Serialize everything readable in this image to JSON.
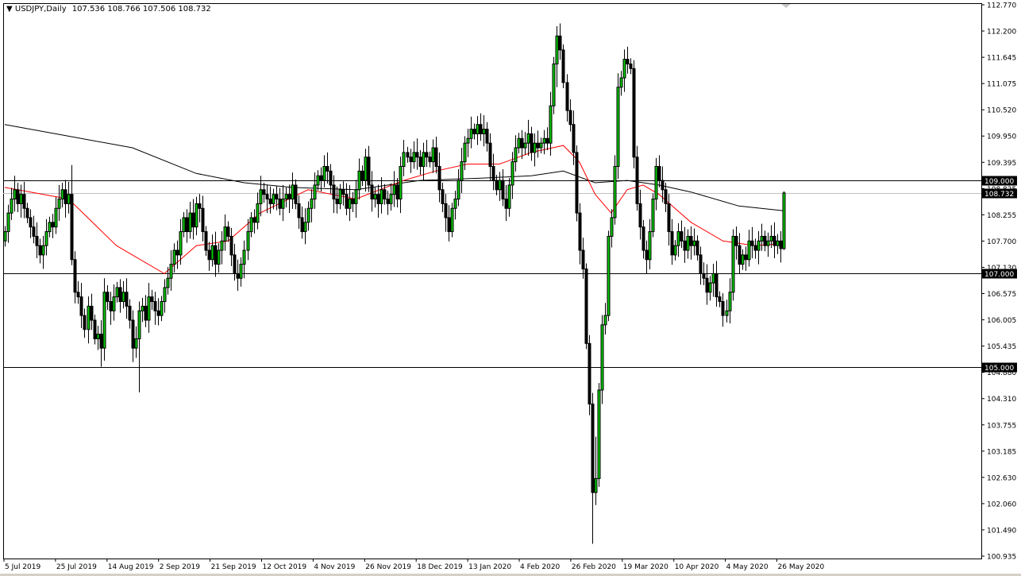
{
  "header": {
    "symbol_timeframe": "USDJPY,Daily",
    "ohlc": "107.536 108.766 107.506 108.732"
  },
  "colors": {
    "bull": "#00cc00",
    "bear": "#000000",
    "ma_fast": "#ff0000",
    "ma_slow": "#000000",
    "price_line": "#c0c0c0"
  },
  "chart_data": {
    "type": "candlestick",
    "title": "USDJPY,Daily",
    "ylim": [
      100.935,
      112.77
    ],
    "yticks": [
      "112.770",
      "112.200",
      "111.645",
      "111.075",
      "110.520",
      "109.950",
      "109.395",
      "108.825",
      "108.255",
      "107.700",
      "107.130",
      "106.575",
      "106.005",
      "105.435",
      "104.880",
      "104.310",
      "103.755",
      "103.185",
      "102.630",
      "102.060",
      "101.490",
      "100.935"
    ],
    "xticks": [
      "5 Jul 2019",
      "25 Jul 2019",
      "14 Aug 2019",
      "2 Sep 2019",
      "21 Sep 2019",
      "12 Oct 2019",
      "4 Nov 2019",
      "26 Nov 2019",
      "18 Dec 2019",
      "13 Jan 2020",
      "4 Feb 2020",
      "26 Feb 2020",
      "19 Mar 2020",
      "10 Apr 2020",
      "4 May 2020",
      "26 May 2020"
    ],
    "closes": [
      107.9,
      108.3,
      108.6,
      108.8,
      108.5,
      108.7,
      108.4,
      108.2,
      108.0,
      107.8,
      107.6,
      107.4,
      107.6,
      107.9,
      108.1,
      108.0,
      108.4,
      108.6,
      108.8,
      108.5,
      108.7,
      107.3,
      106.6,
      106.5,
      106.1,
      105.8,
      106.3,
      106.0,
      105.6,
      105.7,
      105.4,
      106.6,
      106.4,
      106.2,
      106.5,
      106.7,
      106.4,
      106.6,
      106.3,
      106.0,
      105.4,
      105.6,
      106.2,
      106.3,
      106.0,
      106.5,
      106.4,
      106.2,
      106.1,
      106.4,
      106.7,
      106.9,
      107.2,
      107.5,
      107.4,
      107.9,
      108.2,
      107.9,
      108.3,
      108.0,
      108.5,
      108.4,
      107.9,
      107.5,
      107.3,
      107.6,
      107.2,
      107.5,
      107.7,
      108.0,
      107.8,
      107.4,
      107.0,
      106.9,
      107.2,
      107.5,
      107.9,
      108.2,
      108.1,
      108.5,
      108.8,
      108.7,
      108.6,
      108.5,
      108.7,
      108.6,
      108.4,
      108.6,
      108.7,
      108.6,
      108.9,
      108.5,
      108.2,
      107.9,
      108.1,
      108.4,
      108.6,
      108.9,
      109.1,
      109.0,
      109.3,
      109.2,
      108.9,
      108.6,
      108.5,
      108.8,
      108.7,
      108.4,
      108.6,
      108.5,
      108.8,
      109.2,
      109.0,
      109.5,
      108.9,
      108.6,
      108.7,
      108.5,
      108.8,
      108.6,
      108.5,
      108.7,
      108.9,
      108.6,
      109.3,
      109.6,
      109.5,
      109.4,
      109.6,
      109.5,
      109.3,
      109.6,
      109.5,
      109.4,
      109.7,
      109.3,
      108.8,
      108.5,
      108.2,
      107.9,
      108.4,
      108.6,
      109.0,
      109.4,
      109.8,
      109.9,
      110.1,
      110.0,
      110.2,
      110.0,
      110.1,
      109.8,
      109.3,
      109.0,
      108.8,
      109.0,
      108.6,
      108.4,
      108.9,
      109.4,
      109.7,
      109.9,
      109.7,
      109.8,
      110.0,
      109.6,
      109.8,
      109.7,
      109.8,
      109.9,
      109.8,
      110.6,
      111.5,
      112.1,
      111.8,
      111.1,
      110.5,
      110.2,
      109.6,
      108.3,
      107.5,
      107.1,
      105.5,
      104.2,
      102.3,
      102.6,
      104.5,
      105.9,
      106.1,
      107.8,
      108.2,
      109.3,
      111.0,
      111.2,
      111.6,
      111.5,
      111.4,
      109.5,
      108.5,
      108.0,
      107.5,
      107.3,
      107.9,
      108.6,
      109.3,
      109.0,
      108.8,
      108.5,
      107.9,
      107.4,
      107.6,
      107.9,
      107.7,
      107.5,
      107.8,
      107.6,
      107.7,
      107.4,
      107.0,
      106.9,
      106.6,
      106.8,
      107.0,
      106.5,
      106.4,
      106.1,
      106.2,
      106.6,
      107.8,
      107.6,
      107.2,
      107.4,
      107.3,
      107.7,
      107.6,
      107.5,
      107.7,
      107.8,
      107.6,
      107.7,
      107.8,
      107.6,
      107.7,
      107.536,
      108.732
    ],
    "last_candle": {
      "open": 107.536,
      "high": 108.766,
      "low": 107.506,
      "close": 108.732
    },
    "extremes": [
      [
        21,
        109.33,
        107.2
      ],
      [
        30,
        106.0,
        105.0
      ],
      [
        42,
        106.4,
        104.45
      ],
      [
        173,
        112.22,
        111.0
      ],
      [
        184,
        104.4,
        101.2
      ],
      [
        194,
        111.72,
        110.9
      ],
      [
        185,
        103.5,
        102.1
      ]
    ],
    "ma_fast": [
      [
        0,
        108.85
      ],
      [
        20,
        108.6
      ],
      [
        35,
        107.6
      ],
      [
        50,
        107.0
      ],
      [
        60,
        107.6
      ],
      [
        70,
        107.7
      ],
      [
        80,
        108.3
      ],
      [
        95,
        108.8
      ],
      [
        110,
        108.6
      ],
      [
        125,
        109.0
      ],
      [
        135,
        109.2
      ],
      [
        145,
        109.35
      ],
      [
        155,
        109.35
      ],
      [
        165,
        109.6
      ],
      [
        175,
        109.75
      ],
      [
        180,
        109.4
      ],
      [
        185,
        108.7
      ],
      [
        190,
        108.3
      ],
      [
        195,
        108.8
      ],
      [
        200,
        108.9
      ],
      [
        205,
        108.7
      ],
      [
        215,
        108.1
      ],
      [
        225,
        107.7
      ],
      [
        235,
        107.6
      ],
      [
        244,
        107.65
      ]
    ],
    "ma_slow": [
      [
        0,
        110.2
      ],
      [
        20,
        109.95
      ],
      [
        40,
        109.7
      ],
      [
        60,
        109.15
      ],
      [
        75,
        108.95
      ],
      [
        90,
        108.85
      ],
      [
        110,
        108.8
      ],
      [
        130,
        109.0
      ],
      [
        150,
        109.05
      ],
      [
        165,
        109.1
      ],
      [
        175,
        109.2
      ],
      [
        185,
        108.95
      ],
      [
        195,
        109.0
      ],
      [
        205,
        108.9
      ],
      [
        215,
        108.75
      ],
      [
        230,
        108.45
      ],
      [
        244,
        108.35
      ]
    ],
    "levels": [
      {
        "price": 109.0,
        "label": "109.000"
      },
      {
        "price": 107.0,
        "label": "107.000"
      },
      {
        "price": 105.0,
        "label": "105.000"
      }
    ],
    "current_price": {
      "price": 108.732,
      "label": "108.732"
    }
  }
}
